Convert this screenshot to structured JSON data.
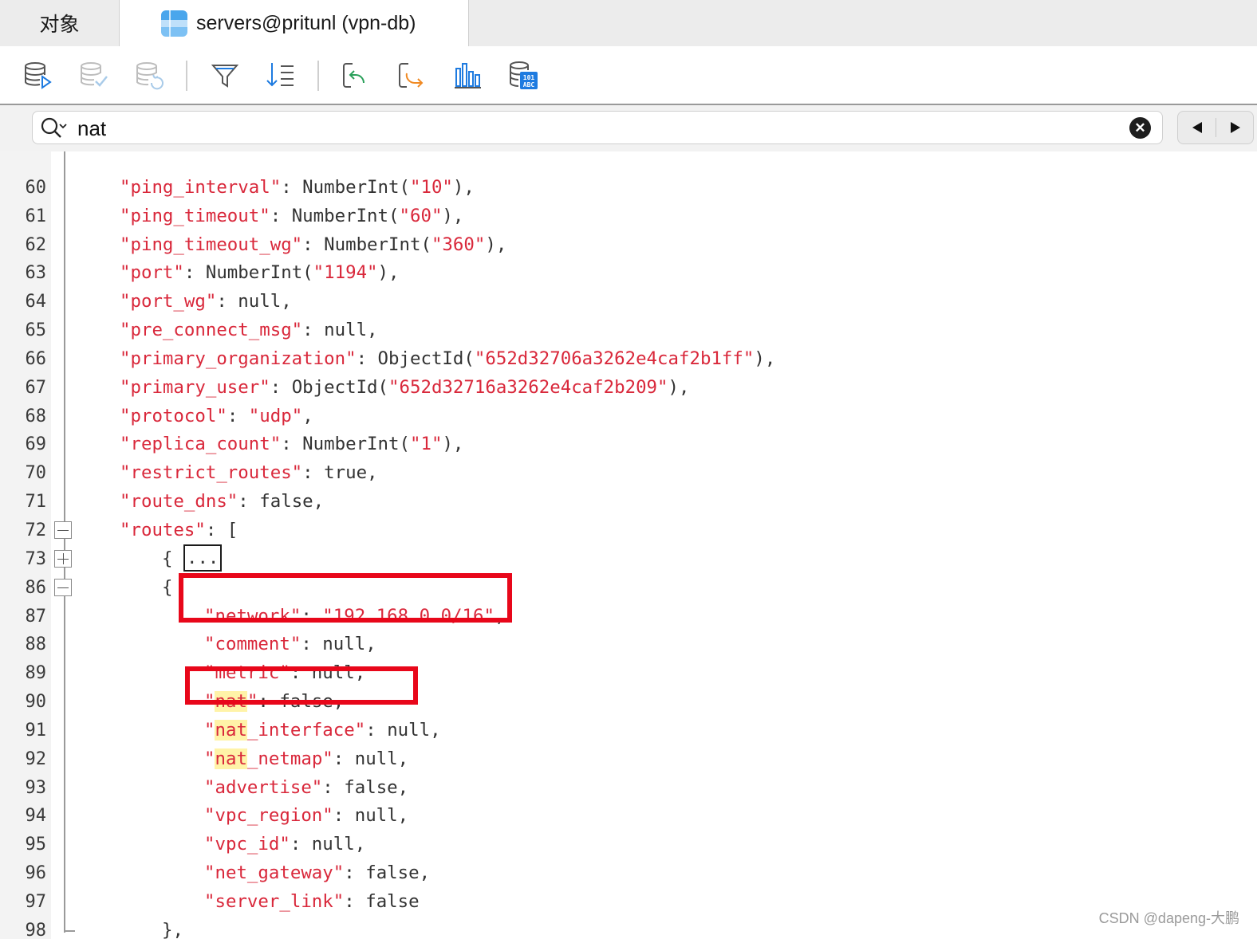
{
  "tabs": [
    {
      "label": "对象"
    },
    {
      "label": "servers@pritunl (vpn-db)"
    }
  ],
  "search": {
    "value": "nat",
    "placeholder": ""
  },
  "icons": {
    "toolbar": [
      "db-run-icon",
      "db-check-icon",
      "db-refresh-icon",
      "filter-icon",
      "sort-icon",
      "import-icon",
      "export-icon",
      "chart-icon",
      "data-generator-icon"
    ],
    "clear": "clear-search-icon",
    "prev": "previous-match-icon",
    "next": "next-match-icon"
  },
  "editor": {
    "lines": [
      {
        "n": "",
        "indent": 0,
        "tokens": []
      },
      {
        "n": "60",
        "indent": 1,
        "tokens": [
          [
            "k",
            "\"ping_interval\""
          ],
          [
            "p",
            ": NumberInt("
          ],
          [
            "s",
            "\"10\""
          ],
          [
            "p",
            "),"
          ]
        ]
      },
      {
        "n": "61",
        "indent": 1,
        "tokens": [
          [
            "k",
            "\"ping_timeout\""
          ],
          [
            "p",
            ": NumberInt("
          ],
          [
            "s",
            "\"60\""
          ],
          [
            "p",
            "),"
          ]
        ]
      },
      {
        "n": "62",
        "indent": 1,
        "tokens": [
          [
            "k",
            "\"ping_timeout_wg\""
          ],
          [
            "p",
            ": NumberInt("
          ],
          [
            "s",
            "\"360\""
          ],
          [
            "p",
            "),"
          ]
        ]
      },
      {
        "n": "63",
        "indent": 1,
        "tokens": [
          [
            "k",
            "\"port\""
          ],
          [
            "p",
            ": NumberInt("
          ],
          [
            "s",
            "\"1194\""
          ],
          [
            "p",
            "),"
          ]
        ]
      },
      {
        "n": "64",
        "indent": 1,
        "tokens": [
          [
            "k",
            "\"port_wg\""
          ],
          [
            "p",
            ": null,"
          ]
        ]
      },
      {
        "n": "65",
        "indent": 1,
        "tokens": [
          [
            "k",
            "\"pre_connect_msg\""
          ],
          [
            "p",
            ": null,"
          ]
        ]
      },
      {
        "n": "66",
        "indent": 1,
        "tokens": [
          [
            "k",
            "\"primary_organization\""
          ],
          [
            "p",
            ": ObjectId("
          ],
          [
            "s",
            "\"652d32706a3262e4caf2b1ff\""
          ],
          [
            "p",
            "),"
          ]
        ]
      },
      {
        "n": "67",
        "indent": 1,
        "tokens": [
          [
            "k",
            "\"primary_user\""
          ],
          [
            "p",
            ": ObjectId("
          ],
          [
            "s",
            "\"652d32716a3262e4caf2b209\""
          ],
          [
            "p",
            "),"
          ]
        ]
      },
      {
        "n": "68",
        "indent": 1,
        "tokens": [
          [
            "k",
            "\"protocol\""
          ],
          [
            "p",
            ": "
          ],
          [
            "s",
            "\"udp\""
          ],
          [
            "p",
            ","
          ]
        ]
      },
      {
        "n": "69",
        "indent": 1,
        "tokens": [
          [
            "k",
            "\"replica_count\""
          ],
          [
            "p",
            ": NumberInt("
          ],
          [
            "s",
            "\"1\""
          ],
          [
            "p",
            "),"
          ]
        ]
      },
      {
        "n": "70",
        "indent": 1,
        "tokens": [
          [
            "k",
            "\"restrict_routes\""
          ],
          [
            "p",
            ": true,"
          ]
        ]
      },
      {
        "n": "71",
        "indent": 1,
        "tokens": [
          [
            "k",
            "\"route_dns\""
          ],
          [
            "p",
            ": false,"
          ]
        ]
      },
      {
        "n": "72",
        "indent": 1,
        "fold": "minus",
        "tokens": [
          [
            "k",
            "\"routes\""
          ],
          [
            "p",
            ": ["
          ]
        ]
      },
      {
        "n": "73",
        "indent": 2,
        "fold": "plus",
        "tokens": [
          [
            "p",
            "{ "
          ],
          [
            "e",
            "..."
          ]
        ]
      },
      {
        "n": "86",
        "indent": 2,
        "fold": "minus",
        "tokens": [
          [
            "p",
            "{"
          ]
        ]
      },
      {
        "n": "87",
        "indent": 3,
        "tokens": [
          [
            "k",
            "\"network\""
          ],
          [
            "p",
            ": "
          ],
          [
            "s",
            "\"192.168.0.0/16\""
          ],
          [
            "p",
            ","
          ]
        ]
      },
      {
        "n": "88",
        "indent": 3,
        "tokens": [
          [
            "k",
            "\"comment\""
          ],
          [
            "p",
            ": null,"
          ]
        ]
      },
      {
        "n": "89",
        "indent": 3,
        "tokens": [
          [
            "k",
            "\"metric\""
          ],
          [
            "p",
            ": null,"
          ]
        ]
      },
      {
        "n": "90",
        "indent": 3,
        "tokens": [
          [
            "k",
            "\""
          ],
          [
            "h",
            "nat"
          ],
          [
            "k",
            "\""
          ],
          [
            "p",
            ": false,"
          ]
        ]
      },
      {
        "n": "91",
        "indent": 3,
        "tokens": [
          [
            "k",
            "\""
          ],
          [
            "h",
            "nat"
          ],
          [
            "k",
            "_interface\""
          ],
          [
            "p",
            ": null,"
          ]
        ]
      },
      {
        "n": "92",
        "indent": 3,
        "tokens": [
          [
            "k",
            "\""
          ],
          [
            "h",
            "nat"
          ],
          [
            "k",
            "_netmap\""
          ],
          [
            "p",
            ": null,"
          ]
        ]
      },
      {
        "n": "93",
        "indent": 3,
        "tokens": [
          [
            "k",
            "\"advertise\""
          ],
          [
            "p",
            ": false,"
          ]
        ]
      },
      {
        "n": "94",
        "indent": 3,
        "tokens": [
          [
            "k",
            "\"vpc_region\""
          ],
          [
            "p",
            ": null,"
          ]
        ]
      },
      {
        "n": "95",
        "indent": 3,
        "tokens": [
          [
            "k",
            "\"vpc_id\""
          ],
          [
            "p",
            ": null,"
          ]
        ]
      },
      {
        "n": "96",
        "indent": 3,
        "tokens": [
          [
            "k",
            "\"net_gateway\""
          ],
          [
            "p",
            ": false,"
          ]
        ]
      },
      {
        "n": "97",
        "indent": 3,
        "tokens": [
          [
            "k",
            "\"server_link\""
          ],
          [
            "p",
            ": false"
          ]
        ]
      },
      {
        "n": "98",
        "indent": 2,
        "foldEnd": true,
        "tokens": [
          [
            "p",
            "},"
          ]
        ]
      }
    ]
  },
  "watermark": "CSDN @dapeng-大鹏"
}
